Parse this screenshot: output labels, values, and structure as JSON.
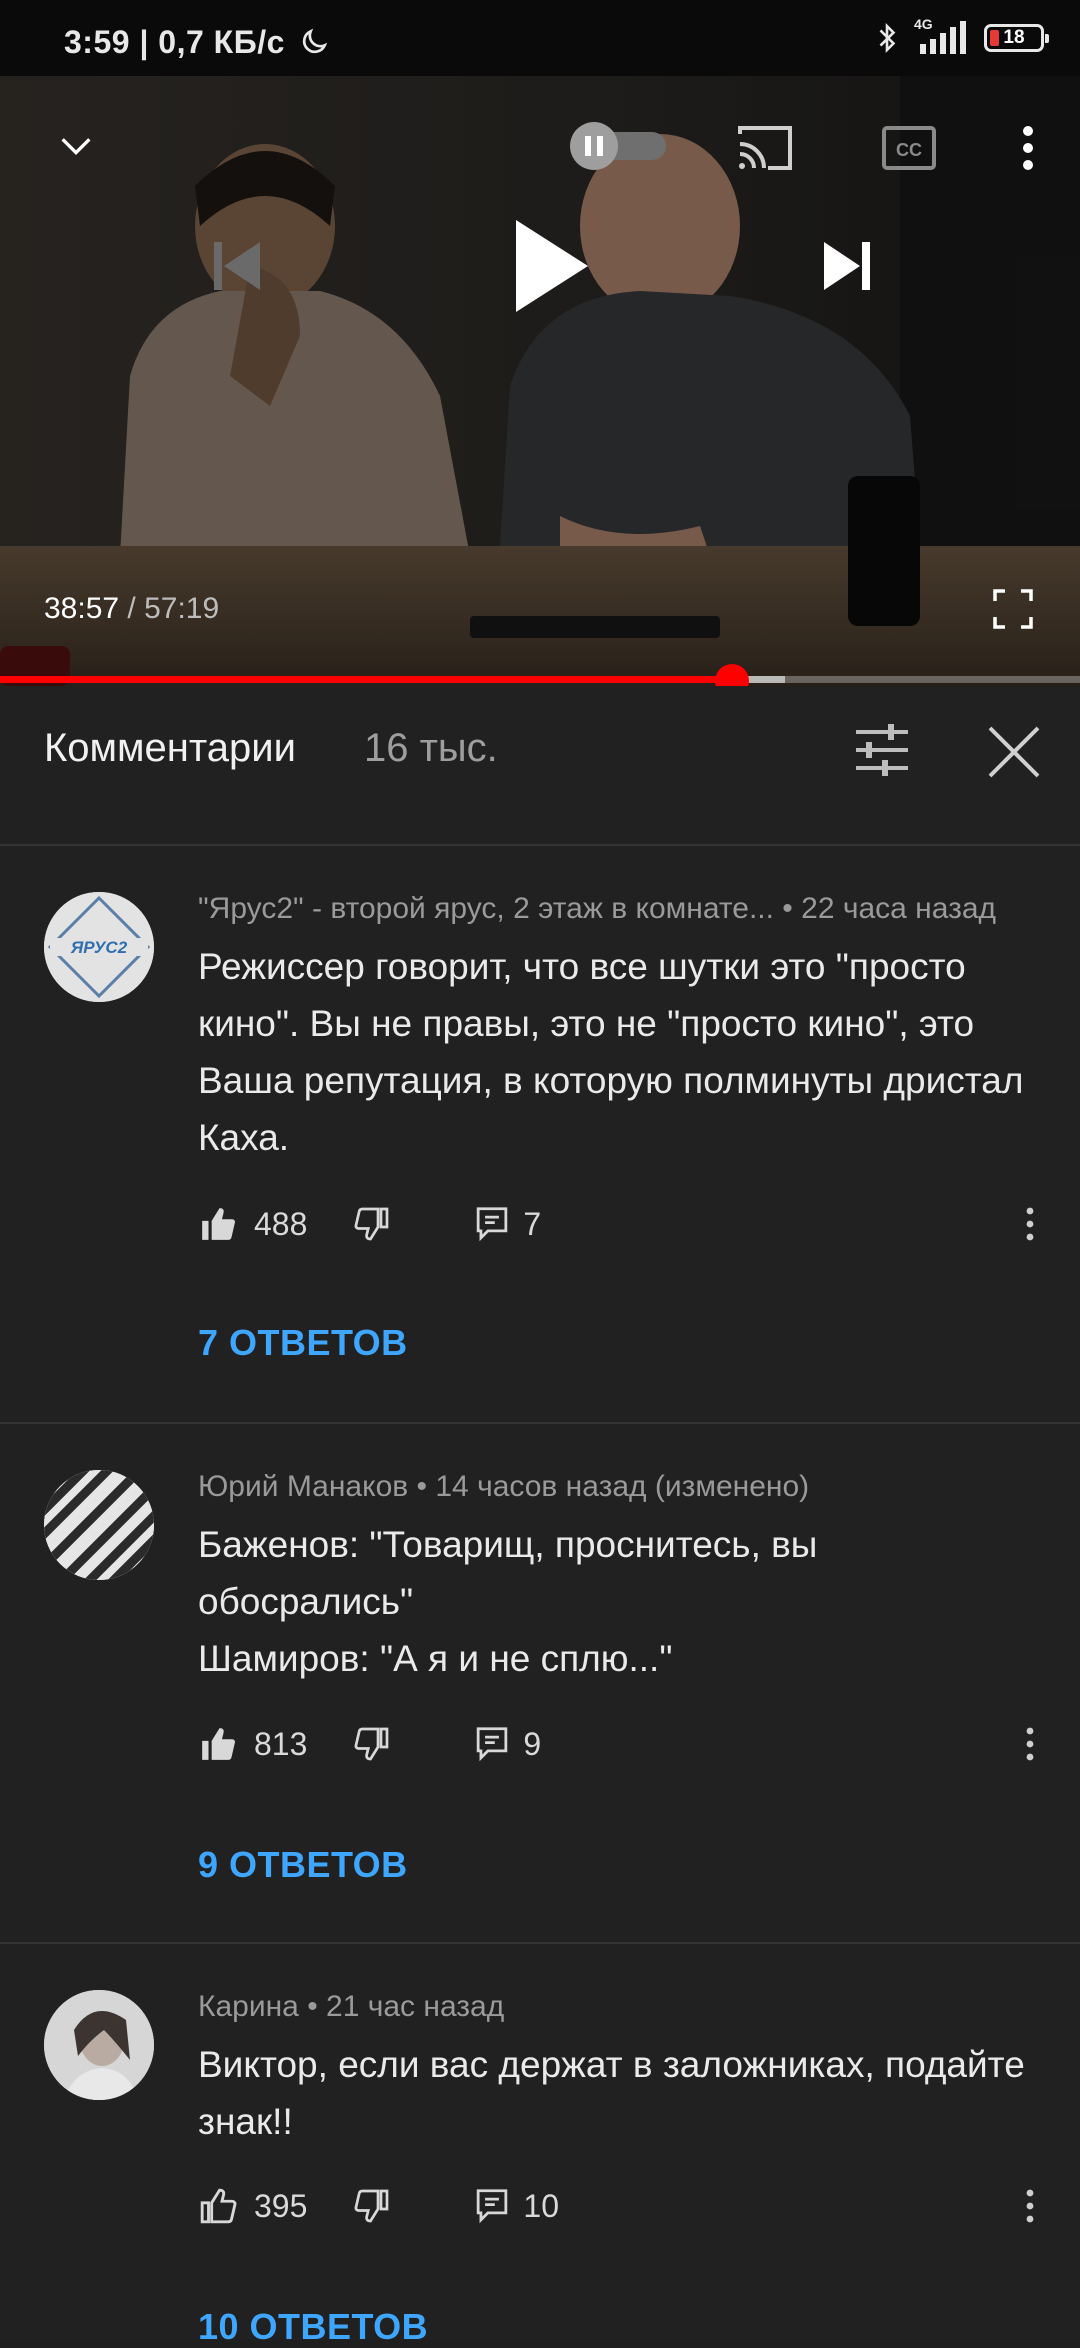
{
  "status_bar": {
    "time_speed": "3:59 | 0,7 КБ/с",
    "network": "4G",
    "battery": "18",
    "icons": [
      "moon-icon",
      "bluetooth-icon",
      "signal-icon",
      "battery-icon"
    ]
  },
  "player": {
    "current_time": "38:57",
    "separator": " / ",
    "total_time": "57:19",
    "progress_fraction": 0.678,
    "buffer_fraction": 0.727,
    "icons": [
      "chevron-down-icon",
      "autoplay-toggle-icon",
      "cast-icon",
      "captions-icon",
      "more-vert-icon",
      "previous-icon",
      "play-icon",
      "next-icon",
      "fullscreen-icon"
    ]
  },
  "comments_header": {
    "title": "Комментарии",
    "count": "16 тыс."
  },
  "comments": [
    {
      "meta": "\"Ярус2\" - второй ярус, 2 этаж в комнате... • 22 часа назад",
      "text": "Режиссер говорит, что все шутки это \"просто кино\". Вы не правы, это не \"просто кино\", это Ваша репутация, в которую полминуты дристал Каха.",
      "likes": "488",
      "replies_count": "7",
      "replies_link": "7 ОТВЕТОВ",
      "liked": true
    },
    {
      "meta": "Юрий Манаков • 14 часов назад (изменено)",
      "text": "Баженов: \"Товарищ, проснитесь, вы обосрались\"\nШамиров: \"А я и не сплю...\"",
      "likes": "813",
      "replies_count": "9",
      "replies_link": "9 ОТВЕТОВ",
      "liked": true
    },
    {
      "meta": "Карина • 21 час назад",
      "text": "Виктор, если вас держат в заложниках, подайте знак!!",
      "likes": "395",
      "replies_count": "10",
      "replies_link": "10 ОТВЕТОВ",
      "liked": false
    }
  ],
  "colors": {
    "background": "#212121",
    "accent_red": "#ff0000",
    "link_blue": "#3ea6ff",
    "battery_low": "#e53935"
  }
}
